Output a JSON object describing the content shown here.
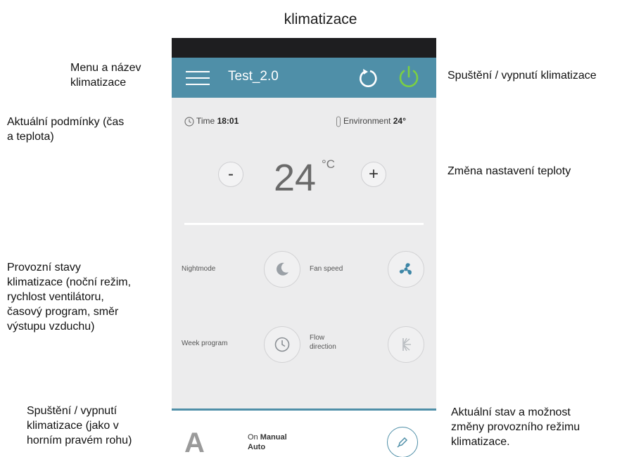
{
  "heading": "klimatizace",
  "annotations": {
    "menu": [
      "Menu a název",
      "klimatizace"
    ],
    "conditions": [
      "Aktuální podmínky (čas",
      "a teplota)"
    ],
    "states": [
      "Provozní stavy",
      "klimatizace (noční režim,",
      "rychlost ventilátoru,",
      "časový program, směr",
      "výstupu vzduchu)"
    ],
    "bottom_power": [
      "Spuštění / vypnutí",
      "klimatizace (jako v",
      "horním pravém rohu)"
    ],
    "power": [
      "Spuštění / vypnutí klimatizace"
    ],
    "temp_change": [
      "Změna nastavení teploty"
    ],
    "mode_status": [
      "Aktuální stav a možnost",
      "změny provozního režimu",
      "klimatizace."
    ]
  },
  "app": {
    "title": "Test_2.0",
    "time_label": "Time",
    "time_value": "18:01",
    "env_label": "Environment",
    "env_value": "24°",
    "minus_label": "-",
    "plus_label": "+",
    "temperature": "24",
    "unit": "°C",
    "modes": {
      "nightmode": "Nightmode",
      "fan_speed": "Fan speed",
      "week_program": "Week program",
      "flow_direction": [
        "Flow",
        "direction"
      ]
    },
    "mode_letter": "A",
    "mode_state": [
      "On Manual",
      "Auto"
    ],
    "mode_state_bold": [
      "Manual"
    ]
  },
  "colors": {
    "appbar": "#4f8fa8",
    "power_green": "#7bd042",
    "fan_blue": "#3d86a6"
  }
}
